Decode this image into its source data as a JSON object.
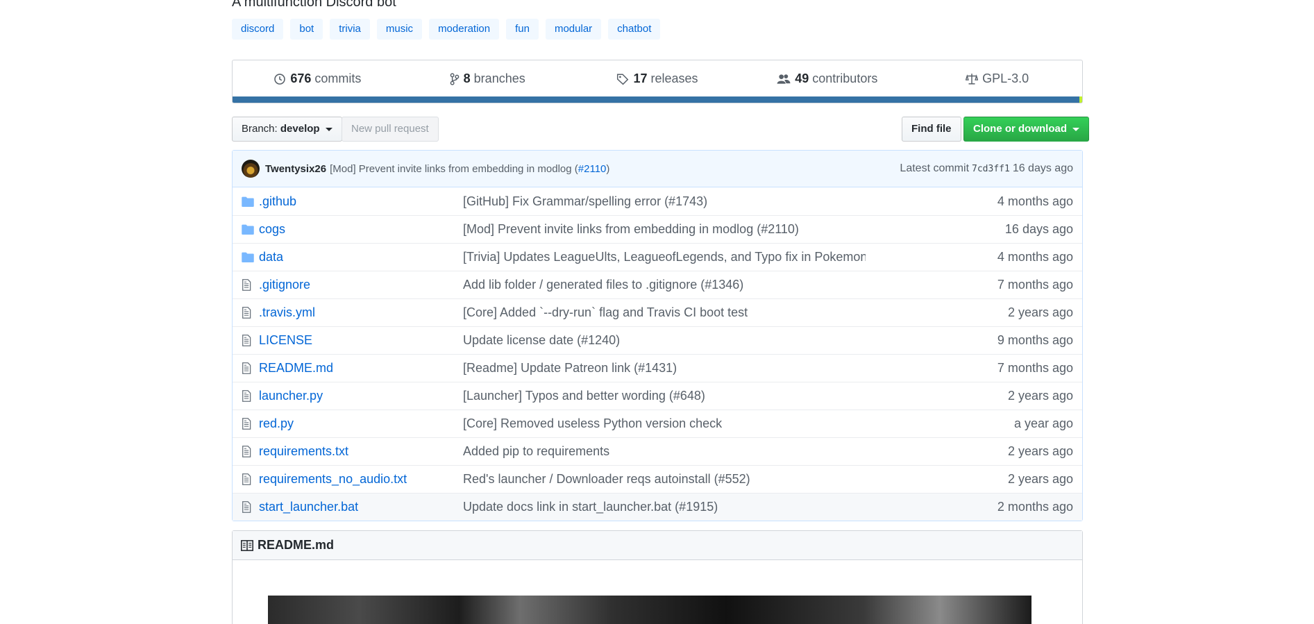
{
  "repo": {
    "description": "A multifunction Discord bot",
    "topics": [
      "discord",
      "bot",
      "trivia",
      "music",
      "moderation",
      "fun",
      "modular",
      "chatbot"
    ]
  },
  "summary": {
    "commits": {
      "count": "676",
      "label": "commits"
    },
    "branches": {
      "count": "8",
      "label": "branches"
    },
    "releases": {
      "count": "17",
      "label": "releases"
    },
    "contributors": {
      "count": "49",
      "label": "contributors"
    },
    "license": "GPL-3.0"
  },
  "toolbar": {
    "branch_prefix": "Branch:",
    "branch_name": "develop",
    "new_pr": "New pull request",
    "find_file": "Find file",
    "clone": "Clone or download"
  },
  "latest_commit": {
    "author": "Twentysix26",
    "message": "[Mod] Prevent invite links from embedding in modlog (",
    "pr": "#2110",
    "message_end": ")",
    "label": "Latest commit",
    "sha": "7cd3ff1",
    "age": "16 days ago"
  },
  "files": [
    {
      "type": "folder",
      "name": ".github",
      "message": "[GitHub] Fix Grammar/spelling error (#1743)",
      "age": "4 months ago"
    },
    {
      "type": "folder",
      "name": "cogs",
      "message": "[Mod] Prevent invite links from embedding in modlog (#2110)",
      "age": "16 days ago"
    },
    {
      "type": "folder",
      "name": "data",
      "message": "[Trivia] Updates LeagueUlts, LeagueofLegends, and Typo fix in Pokemon (…",
      "age": "4 months ago"
    },
    {
      "type": "file",
      "name": ".gitignore",
      "message": "Add lib folder / generated files to .gitignore (#1346)",
      "age": "7 months ago"
    },
    {
      "type": "file",
      "name": ".travis.yml",
      "message": "[Core] Added `--dry-run` flag and Travis CI boot test",
      "age": "2 years ago"
    },
    {
      "type": "file",
      "name": "LICENSE",
      "message": "Update license date (#1240)",
      "age": "9 months ago"
    },
    {
      "type": "file",
      "name": "README.md",
      "message": "[Readme] Update Patreon link (#1431)",
      "age": "7 months ago"
    },
    {
      "type": "file",
      "name": "launcher.py",
      "message": "[Launcher] Typos and better wording (#648)",
      "age": "2 years ago"
    },
    {
      "type": "file",
      "name": "red.py",
      "message": "[Core] Removed useless Python version check",
      "age": "a year ago"
    },
    {
      "type": "file",
      "name": "requirements.txt",
      "message": "Added pip to requirements",
      "age": "2 years ago"
    },
    {
      "type": "file",
      "name": "requirements_no_audio.txt",
      "message": "Red's launcher / Downloader reqs autoinstall (#552)",
      "age": "2 years ago"
    },
    {
      "type": "file",
      "name": "start_launcher.bat",
      "message": "Update docs link in start_launcher.bat (#1915)",
      "age": "2 months ago"
    }
  ],
  "readme": {
    "title": "README.md"
  },
  "colors": {
    "language_bar": "#3572a5",
    "clone_button": "#28a745",
    "link": "#0366d6"
  }
}
